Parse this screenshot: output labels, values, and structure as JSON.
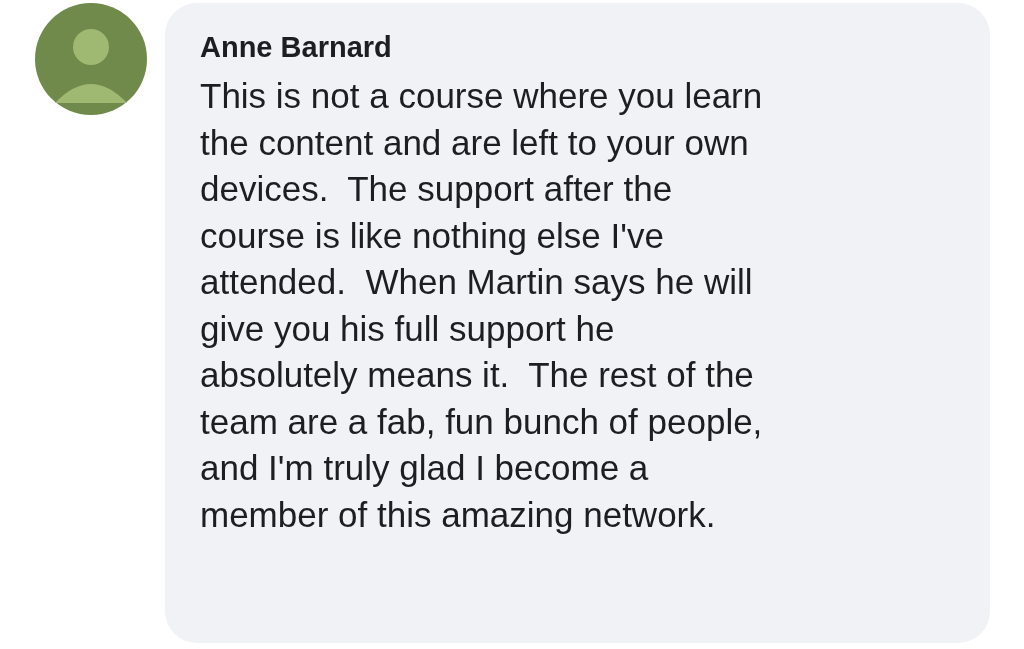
{
  "comment": {
    "author": "Anne Barnard",
    "text": "This is not a course where you learn\nthe content and are left to your own\ndevices.  The support after the\ncourse is like nothing else I've\nattended.  When Martin says he will\ngive you his full support he\nabsolutely means it.  The rest of the\nteam are a fab, fun bunch of people,\nand I'm truly glad I become a\nmember of this amazing network."
  }
}
